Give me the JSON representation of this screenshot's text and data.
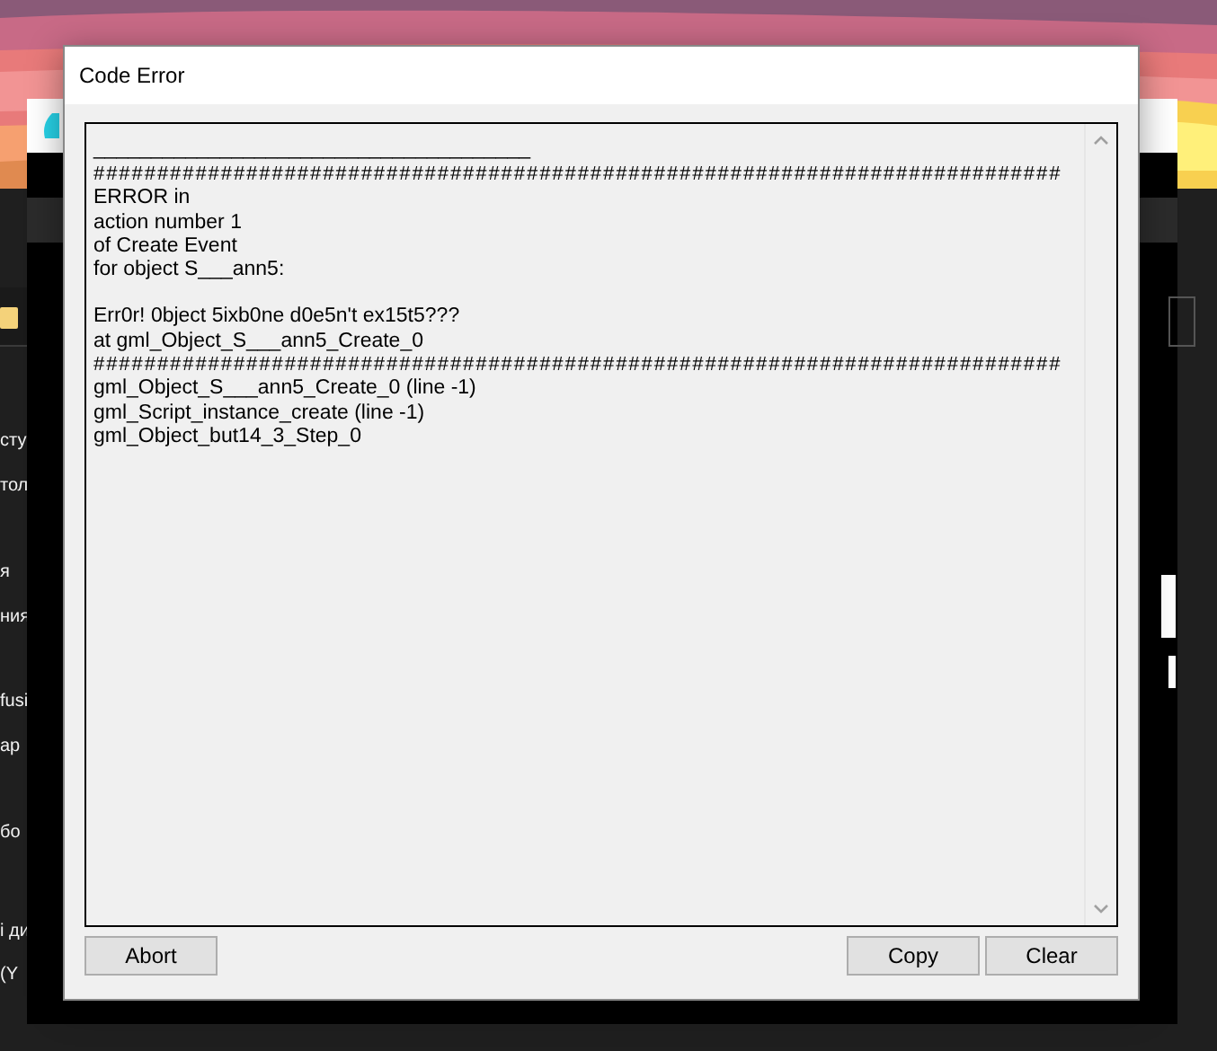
{
  "background_app": {
    "sidebar_items": [
      {
        "label": "сту"
      },
      {
        "label": "тол"
      },
      {
        "label": "я"
      },
      {
        "label": "ния"
      },
      {
        "label": "fusi"
      },
      {
        "label": "ар"
      },
      {
        "label": "бо"
      },
      {
        "label": "і ди"
      },
      {
        "label": "(Y"
      }
    ]
  },
  "dialog": {
    "title": "Code Error",
    "log": [
      {
        "kind": "underline",
        "text": "______________________________________"
      },
      {
        "kind": "hashes",
        "text": "############################################################################"
      },
      {
        "kind": "text",
        "text": "ERROR in"
      },
      {
        "kind": "text",
        "text": "action number 1"
      },
      {
        "kind": "text",
        "text": "of Create Event"
      },
      {
        "kind": "text",
        "text": "for object S___ann5:"
      },
      {
        "kind": "text",
        "text": "Err0r! 0bject 5ixb0ne d0e5n't ex15t5???",
        "gap_before": true
      },
      {
        "kind": "text",
        "text": "at gml_Object_S___ann5_Create_0"
      },
      {
        "kind": "hashes",
        "text": "############################################################################"
      },
      {
        "kind": "text",
        "text": "gml_Object_S___ann5_Create_0 (line -1)"
      },
      {
        "kind": "text",
        "text": "gml_Script_instance_create (line -1)"
      },
      {
        "kind": "text",
        "text": "gml_Object_but14_3_Step_0"
      }
    ],
    "buttons": [
      {
        "label": "Abort"
      },
      {
        "label": "Copy"
      },
      {
        "label": "Clear"
      }
    ]
  }
}
